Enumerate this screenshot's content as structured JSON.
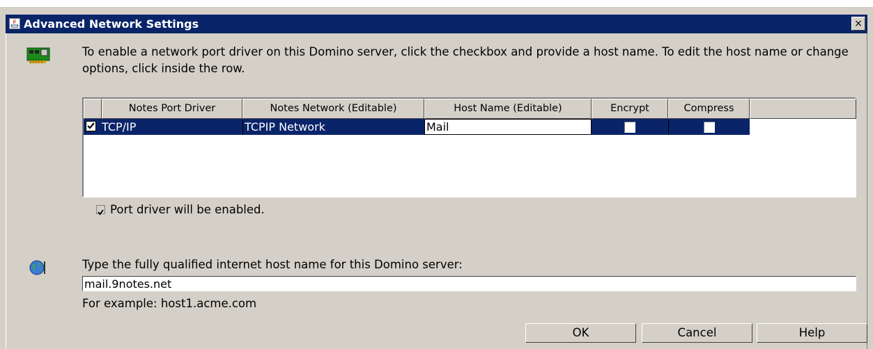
{
  "window": {
    "title": "Advanced Network Settings",
    "close_glyph": "×"
  },
  "instructions": "To enable a network port driver on this Domino server, click the checkbox and provide a host name. To edit the host name or change options, click inside the row.",
  "table": {
    "columns": [
      "",
      "Notes Port Driver",
      "Notes Network (Editable)",
      "Host Name (Editable)",
      "Encrypt",
      "Compress",
      ""
    ],
    "rows": [
      {
        "enabled": true,
        "driver": "TCP/IP",
        "network": "TCPIP Network",
        "host": "Mail",
        "encrypt": false,
        "compress": false
      }
    ]
  },
  "port_status": {
    "checked": true,
    "label": "Port driver will be enabled."
  },
  "fqdn": {
    "label": "Type the fully qualified internet host name for this Domino server:",
    "value": "mail.9notes.net",
    "example": "For example: host1.acme.com"
  },
  "buttons": {
    "ok": "OK",
    "cancel": "Cancel",
    "help": "Help"
  },
  "icons": {
    "title": "java-app-icon",
    "network": "network-card-icon",
    "globe": "globe-icon"
  },
  "colors": {
    "titlebar": "#0a246a",
    "selection": "#0a246a",
    "dialog": "#d4d0c8"
  }
}
